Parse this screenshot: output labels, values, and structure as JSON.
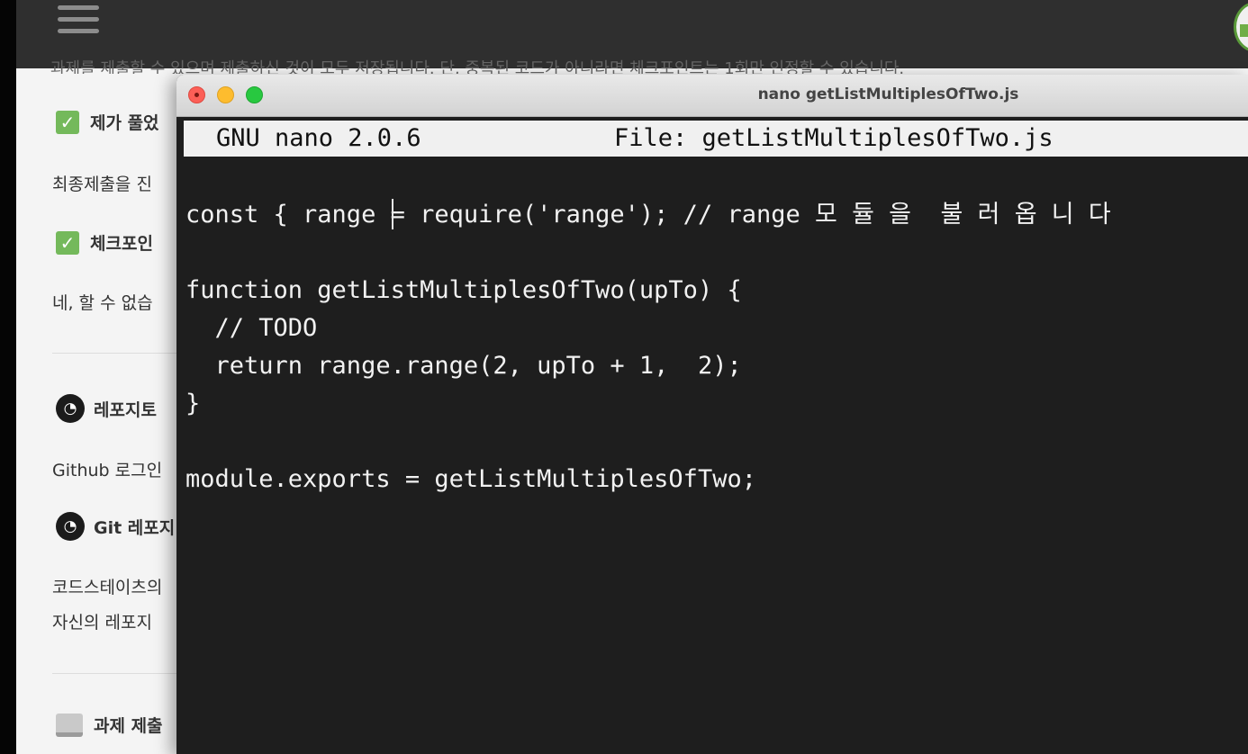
{
  "background_page": {
    "menu_icon": "hamburger-icon",
    "avatar_icon": "avatar-icon",
    "cut_off_text": "과제를 제출할 수 있으며 제출하신 것이 모두 저장됩니다. 단, 중복된 코드가 아니라면 체크포인트는 1회만 인정할 수 있습니다.",
    "sections": [
      {
        "icon": "checkbox-icon",
        "title": "제가 풀었",
        "text": "최종제출을 진"
      },
      {
        "icon": "checkbox-icon",
        "title": "체크포인",
        "text": "네, 할 수 없습"
      },
      {
        "icon": "github-icon",
        "title": "레포지토",
        "text": "Github 로그인"
      },
      {
        "icon": "github-icon",
        "title": "Git 레포지",
        "text_lines": [
          "코드스테이츠의",
          "자신의 레포지"
        ]
      },
      {
        "icon": "laptop-icon",
        "title": "과제 제출"
      }
    ]
  },
  "terminal": {
    "window_title": "nano getListMultiplesOfTwo.js",
    "nano_version": "GNU nano 2.0.6",
    "file_label": "File: getListMultiplesOfTwo.js",
    "code_lines": [
      "const { range = require('range'); // range 모 듈 을  불 러 옵 니 다",
      "",
      "function getListMultiplesOfTwo(upTo) {",
      "  // TODO",
      "  return range.range(2, upTo + 1,  2);",
      "}",
      "",
      "module.exports = getListMultiplesOfTwo;"
    ]
  }
}
